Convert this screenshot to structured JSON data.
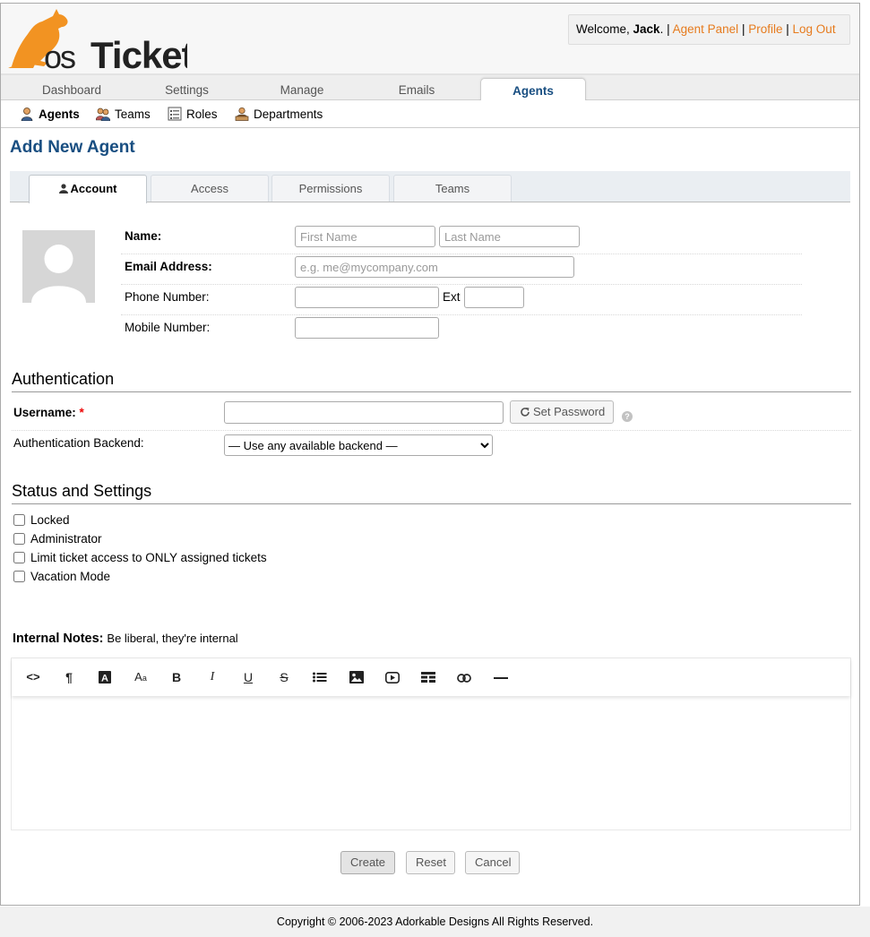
{
  "header": {
    "logo_text": "osTicket",
    "welcome_prefix": "Welcome, ",
    "user_name": "Jack",
    "welcome_suffix": ". |",
    "agent_panel": "Agent Panel",
    "profile": "Profile",
    "logout": "Log Out",
    "separator": "|",
    "link_color": "#e67b1e"
  },
  "nav": {
    "tabs": [
      {
        "label": "Dashboard"
      },
      {
        "label": "Settings"
      },
      {
        "label": "Manage"
      },
      {
        "label": "Emails"
      },
      {
        "label": "Agents",
        "active": true
      }
    ]
  },
  "subnav": {
    "items": [
      {
        "label": "Agents",
        "icon": "agent-icon",
        "active": true
      },
      {
        "label": "Teams",
        "icon": "teams-icon"
      },
      {
        "label": "Roles",
        "icon": "roles-icon"
      },
      {
        "label": "Departments",
        "icon": "departments-icon"
      }
    ]
  },
  "page": {
    "title": "Add New Agent",
    "title_color": "#184e81"
  },
  "form_tabs": [
    {
      "label": "Account",
      "icon": "user-icon",
      "active": true
    },
    {
      "label": "Access"
    },
    {
      "label": "Permissions"
    },
    {
      "label": "Teams"
    }
  ],
  "account": {
    "name_label": "Name:",
    "first_name_placeholder": "First Name",
    "last_name_placeholder": "Last Name",
    "email_label": "Email Address:",
    "email_placeholder": "e.g. me@mycompany.com",
    "phone_label": "Phone Number:",
    "ext_label": "Ext",
    "mobile_label": "Mobile Number:"
  },
  "authentication": {
    "title": "Authentication",
    "username_label": "Username:",
    "required_mark": "*",
    "set_password": "Set Password",
    "backend_label": "Authentication Backend:",
    "backend_selected": "— Use any available backend —"
  },
  "status": {
    "title": "Status and Settings",
    "options": [
      {
        "label": "Locked",
        "checked": false
      },
      {
        "label": "Administrator",
        "checked": false
      },
      {
        "label": "Limit ticket access to ONLY assigned tickets",
        "checked": false
      },
      {
        "label": "Vacation Mode",
        "checked": false
      }
    ]
  },
  "notes": {
    "label": "Internal Notes:",
    "hint": "Be liberal, they're internal",
    "toolbar": [
      "code-view-icon",
      "paragraph-icon",
      "font-color-icon",
      "font-size-icon",
      "bold-icon",
      "italic-icon",
      "underline-icon",
      "strikethrough-icon",
      "list-icon",
      "image-icon",
      "video-icon",
      "table-icon",
      "link-icon",
      "horizontal-rule-icon"
    ]
  },
  "actions": {
    "create": "Create",
    "reset": "Reset",
    "cancel": "Cancel"
  },
  "footer": {
    "copyright": "Copyright © 2006-2023 Adorkable Designs All Rights Reserved."
  }
}
